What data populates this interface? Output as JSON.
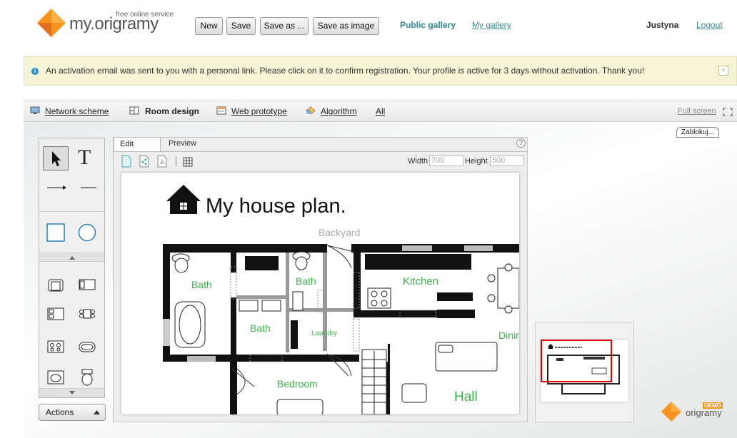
{
  "header": {
    "logo_text": "my.origramy",
    "logo_sub": "free online service",
    "buttons": {
      "new": "New",
      "save": "Save",
      "save_as": "Save as ...",
      "save_image": "Save as image"
    },
    "public_gallery": "Public gallery",
    "my_gallery": "My gallery",
    "user": "Justyna",
    "logout": "Logout"
  },
  "notice": {
    "message": "An activation email was sent to you with a personal link. Please click on it to confirm registration. Your profile is active for 3 days without activation. Thank you!",
    "close": "×"
  },
  "tabs": [
    {
      "label": "Network scheme"
    },
    {
      "label": "Room design"
    },
    {
      "label": "Web prototype"
    },
    {
      "label": "Algorithm"
    },
    {
      "label": "All"
    }
  ],
  "fullscreen": "Full screen",
  "zablokuj": "Zablokuj...",
  "tools": {
    "text_tool": "T"
  },
  "actions": "Actions",
  "editor": {
    "tab_edit": "Edit",
    "tab_preview": "Preview",
    "help": "?",
    "width_label": "Width",
    "width_value": "700",
    "height_label": "Height",
    "height_value": "500"
  },
  "plan": {
    "title": "My house plan.",
    "backyard": "Backyard",
    "rooms": {
      "bath1": "Bath",
      "bath2": "Bath",
      "bath3": "Bath",
      "kitchen": "Kitchen",
      "laundry": "Laundry",
      "dining": "Dinin",
      "bedroom": "Bedroom",
      "hall": "Hall"
    }
  },
  "watermark": {
    "demo": "DEMO",
    "text": "origramy"
  },
  "colors": {
    "accent": "#2f8b94",
    "link": "#3a8f9a",
    "room_label": "#3cb54a",
    "logo_orange": "#f7941d"
  }
}
